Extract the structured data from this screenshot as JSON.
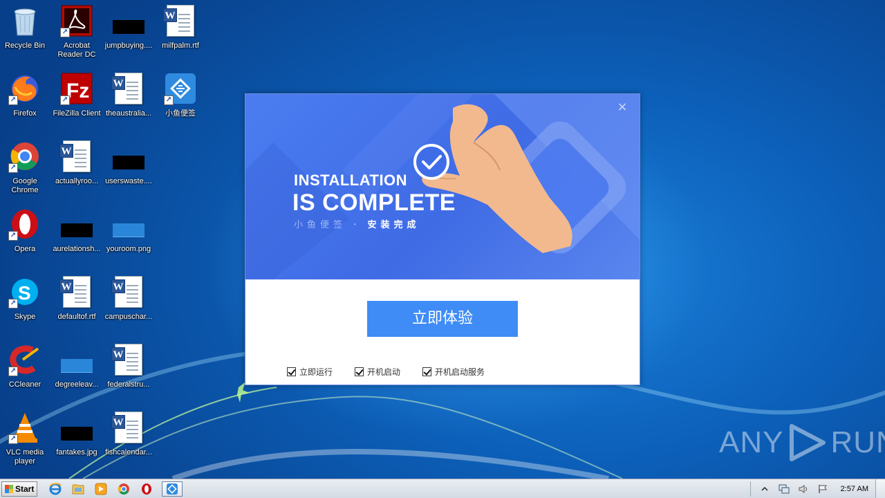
{
  "desktop": {
    "icons": [
      {
        "label": "Recycle Bin",
        "kind": "recycle-bin"
      },
      {
        "label": "Acrobat Reader DC",
        "kind": "acrobat"
      },
      {
        "label": "jumpbuying....",
        "kind": "black-file"
      },
      {
        "label": "milfpalm.rtf",
        "kind": "word-doc"
      },
      {
        "label": "Firefox",
        "kind": "firefox"
      },
      {
        "label": "FileZilla Client",
        "kind": "filezilla"
      },
      {
        "label": "theaustralia...",
        "kind": "word-doc"
      },
      {
        "label": "小鱼便签",
        "kind": "xiaoyu-app"
      },
      {
        "label": "Google Chrome",
        "kind": "chrome"
      },
      {
        "label": "actuallyroo...",
        "kind": "word-doc"
      },
      {
        "label": "userswaste....",
        "kind": "black-file"
      },
      {
        "label": "Opera",
        "kind": "opera"
      },
      {
        "label": "aurelationsh...",
        "kind": "black-file"
      },
      {
        "label": "youroom.png",
        "kind": "blue-file"
      },
      {
        "label": "Skype",
        "kind": "skype"
      },
      {
        "label": "defaultof.rtf",
        "kind": "word-doc"
      },
      {
        "label": "campuschar...",
        "kind": "word-doc"
      },
      {
        "label": "CCleaner",
        "kind": "ccleaner"
      },
      {
        "label": "degreeleav...",
        "kind": "blue-file"
      },
      {
        "label": "federalstru...",
        "kind": "word-doc"
      },
      {
        "label": "VLC media player",
        "kind": "vlc"
      },
      {
        "label": "fantakes.jpg",
        "kind": "black-file"
      },
      {
        "label": "fishcalendar...",
        "kind": "word-doc"
      }
    ]
  },
  "installer": {
    "title_line1": "INSTALLATION",
    "title_line2": "IS COMPLETE",
    "subtitle_a": "小鱼便签",
    "subtitle_dot": "·",
    "subtitle_b": "安装完成",
    "close_glyph": "×",
    "primary_button": "立即体验",
    "options": [
      {
        "label": "立即运行",
        "checked": true
      },
      {
        "label": "开机启动",
        "checked": true
      },
      {
        "label": "开机启动服务",
        "checked": true
      }
    ]
  },
  "watermark": {
    "text_left": "ANY",
    "text_right": "RUN"
  },
  "taskbar": {
    "start_label": "Start",
    "pinned": [
      "internet-explorer-icon",
      "file-explorer-icon",
      "media-player-icon",
      "chrome-icon",
      "opera-icon",
      "xiaoyu-app-icon"
    ],
    "clock": "2:57 AM"
  }
}
